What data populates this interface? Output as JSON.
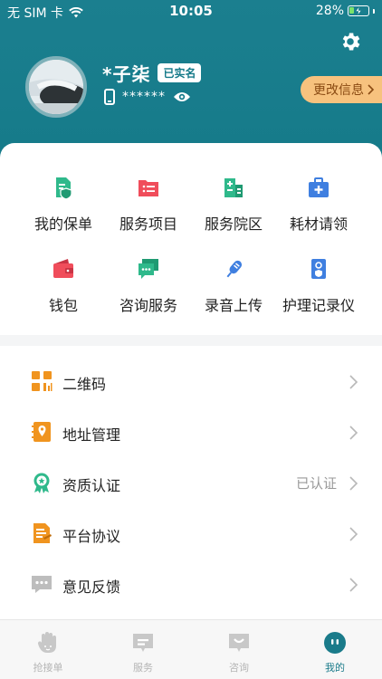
{
  "status_bar": {
    "carrier": "无 SIM 卡",
    "time": "10:05",
    "battery": "28%",
    "battery_level": 0.28
  },
  "profile": {
    "name": "*子柒",
    "verified_badge": "已实名",
    "masked_phone": "******",
    "edit_button": "更改信息",
    "colors": {
      "header": "#157a89",
      "edit_button_bg": "#f7c27e",
      "edit_button_text": "#8a4a12"
    }
  },
  "services": [
    {
      "label": "我的保单",
      "icon": "policy-icon",
      "color": "#2fb98b"
    },
    {
      "label": "服务项目",
      "icon": "service-items-icon",
      "color": "#f04d5b"
    },
    {
      "label": "服务院区",
      "icon": "hospital-campus-icon",
      "color": "#2fb98b"
    },
    {
      "label": "耗材请领",
      "icon": "medical-kit-icon",
      "color": "#3f7fe0"
    },
    {
      "label": "钱包",
      "icon": "wallet-icon",
      "color": "#f04d5b"
    },
    {
      "label": "咨询服务",
      "icon": "consult-chat-icon",
      "color": "#2fb98b"
    },
    {
      "label": "录音上传",
      "icon": "microphone-icon",
      "color": "#3f7fe0"
    },
    {
      "label": "护理记录仪",
      "icon": "nursing-recorder-icon",
      "color": "#3f7fe0"
    }
  ],
  "menu": [
    {
      "label": "二维码",
      "icon": "qr-code-icon",
      "value": "",
      "color": "#f0941f"
    },
    {
      "label": "地址管理",
      "icon": "address-book-icon",
      "value": "",
      "color": "#f0941f"
    },
    {
      "label": "资质认证",
      "icon": "certificate-icon",
      "value": "已认证",
      "color": "#2fb98b"
    },
    {
      "label": "平台协议",
      "icon": "agreement-icon",
      "value": "",
      "color": "#f0941f"
    },
    {
      "label": "意见反馈",
      "icon": "feedback-icon",
      "value": "",
      "color": "#bdbdbd"
    }
  ],
  "tabs": [
    {
      "label": "抢接单",
      "icon": "grab-order-icon",
      "active": false
    },
    {
      "label": "服务",
      "icon": "service-tab-icon",
      "active": false
    },
    {
      "label": "咨询",
      "icon": "consult-tab-icon",
      "active": false
    },
    {
      "label": "我的",
      "icon": "profile-tab-icon",
      "active": true
    }
  ]
}
